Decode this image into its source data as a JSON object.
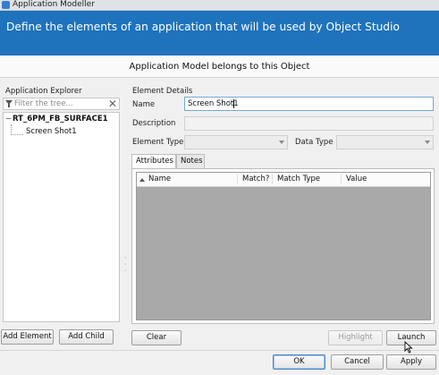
{
  "window": {
    "title": "Application Modeller"
  },
  "banner": {
    "text": "Define the elements of an application that will be used by Object Studio"
  },
  "object_line": "Application Model belongs to this Object",
  "explorer": {
    "heading": "Application Explorer",
    "filter_placeholder": "Filter the tree...",
    "tree": {
      "root": "RT_6PM_FB_SURFACE1",
      "child": "Screen Shot1"
    },
    "add_element_label": "Add Element",
    "add_child_label": "Add Child"
  },
  "details": {
    "heading": "Element Details",
    "name_label": "Name",
    "name_value": "Screen Shot1",
    "description_label": "Description",
    "element_type_label": "Element Type",
    "data_type_label": "Data Type",
    "tabs": [
      "Attributes",
      "Notes"
    ],
    "columns": [
      "Name",
      "Match?",
      "Match Type",
      "Value"
    ],
    "clear_label": "Clear",
    "highlight_label": "Highlight",
    "launch_label": "Launch"
  },
  "footer": {
    "ok_label": "OK",
    "cancel_label": "Cancel",
    "apply_label": "Apply"
  },
  "colors": {
    "banner": "#1e73bc",
    "grid_fill": "#a9a9a9"
  }
}
